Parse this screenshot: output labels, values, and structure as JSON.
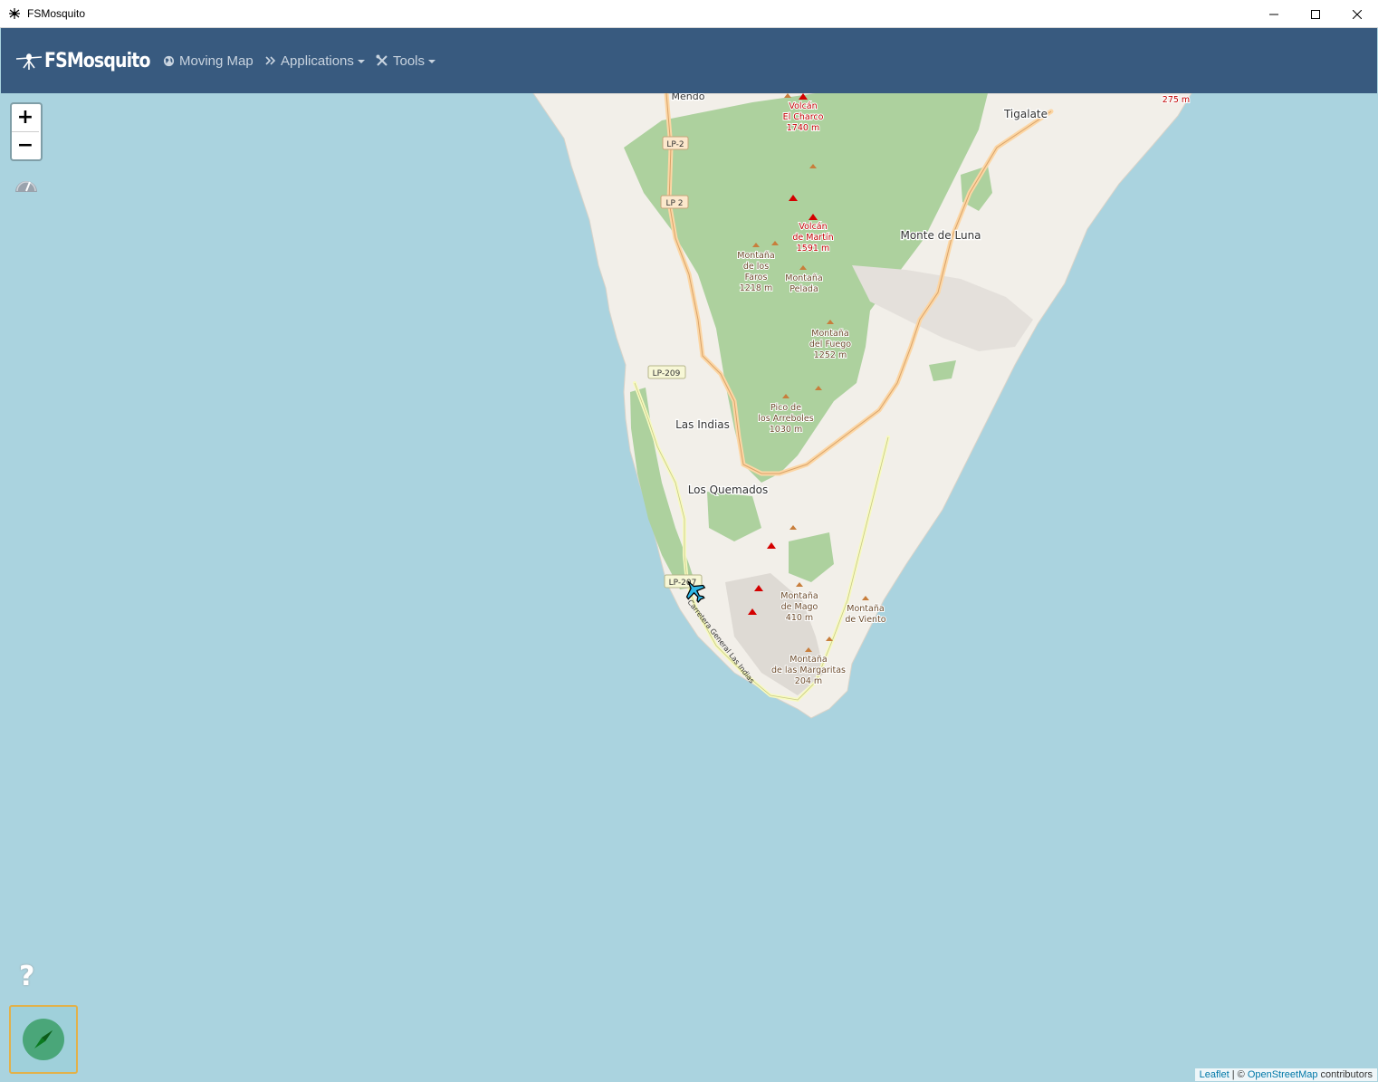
{
  "window": {
    "title": "FSMosquito",
    "controls": [
      "minimize",
      "maximize",
      "close"
    ]
  },
  "navbar": {
    "brand": "FSMosquito",
    "items": [
      {
        "label": "Moving Map",
        "icon": "globe-icon",
        "dropdown": false
      },
      {
        "label": "Applications",
        "icon": "double-chevron-icon",
        "dropdown": true
      },
      {
        "label": "Tools",
        "icon": "tools-icon",
        "dropdown": true
      }
    ]
  },
  "map": {
    "zoom_in": "+",
    "zoom_out": "−",
    "help": "?",
    "colors": {
      "sea": "#aad3df",
      "land": "#f2efe9",
      "forest": "#add19e",
      "road": "#fcd6a4",
      "peak": "#d40000"
    },
    "place_labels": {
      "mendo": "Mendo",
      "tigalate": "Tigalate",
      "monte_de_luna": "Monte de Luna",
      "las_indias": "Las Indias",
      "los_quemados": "Los Quemados",
      "el_charco_1": "Volcán",
      "el_charco_2": "El Charco",
      "el_charco_3": "1740 m",
      "martin_1": "Volcán",
      "martin_2": "de Martín",
      "martin_3": "1591 m",
      "faros_1": "Montaña",
      "faros_2": "de los",
      "faros_3": "Faros",
      "faros_4": "1218 m",
      "pelada_1": "Montaña",
      "pelada_2": "Pelada",
      "fuego_1": "Montaña",
      "fuego_2": "del Fuego",
      "fuego_3": "1252 m",
      "arreboles_1": "Pico de",
      "arreboles_2": "los Arreboles",
      "arreboles_3": "1030 m",
      "mago_1": "Montaña",
      "mago_2": "de Mago",
      "mago_3": "410 m",
      "viento_1": "Montaña",
      "viento_2": "de Viento",
      "margaritas_1": "Montaña",
      "margaritas_2": "de las Margaritas",
      "margaritas_3": "204 m",
      "elev_275": "275 m",
      "street": "Carretera General Las Indias"
    },
    "road_shields": {
      "lp2a": "LP-2",
      "lp2b": "LP 2",
      "lp209": "LP-209",
      "lp207": "LP-207"
    },
    "attribution": {
      "leaflet": "Leaflet",
      "separator": " | © ",
      "osm": "OpenStreetMap",
      "suffix": " contributors"
    }
  }
}
